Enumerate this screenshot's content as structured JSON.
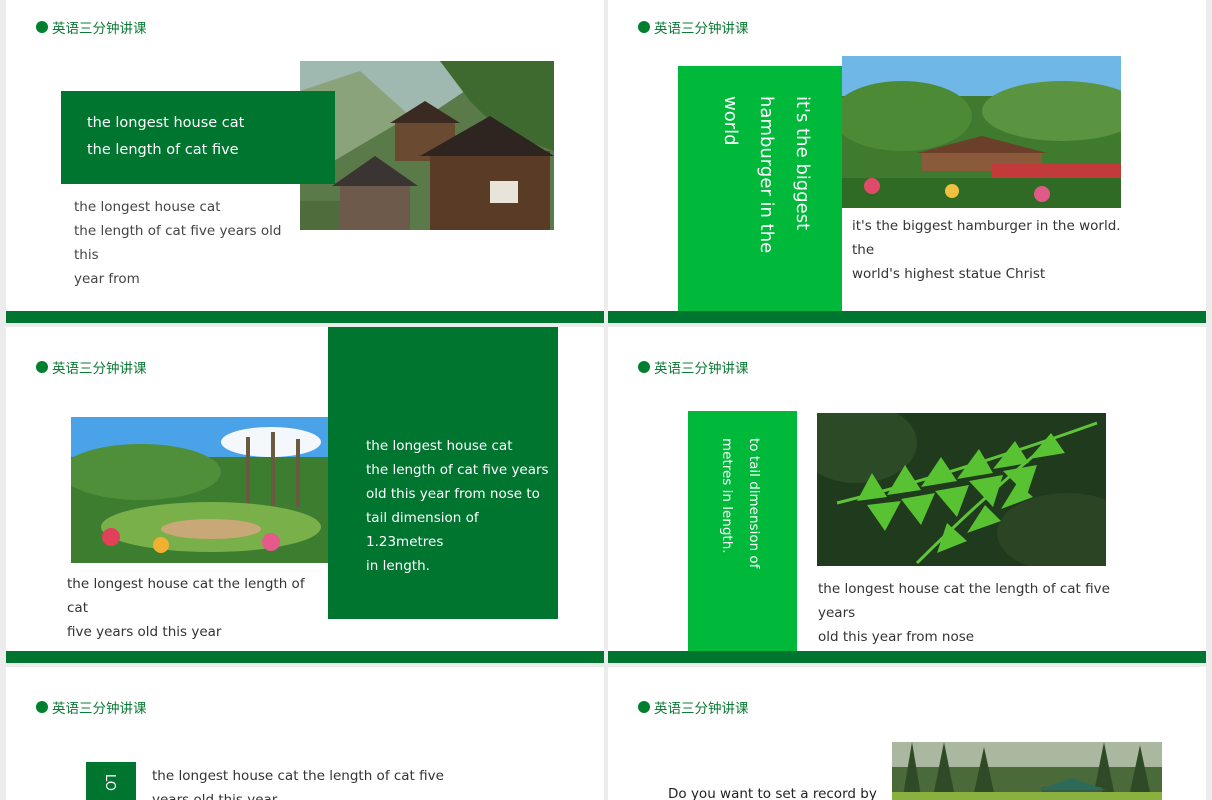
{
  "tag_label": "英语三分钟讲课",
  "colors": {
    "dark_green": "#007530",
    "light_green": "#00b83a"
  },
  "slides": [
    {
      "box": {
        "line1": "the longest house cat",
        "line2": "the length of cat five"
      },
      "body": {
        "line1": "the longest house cat",
        "line2": "the length of cat five years old this",
        "line3": "year from"
      }
    },
    {
      "vertical": {
        "line1": "it's the biggest",
        "line2": "hamburger  in  the",
        "line3": "world"
      },
      "body": {
        "line1": "it's the biggest hamburger  in  the world. the",
        "line2": "world's  highest statue  Christ"
      }
    },
    {
      "box": {
        "line1": "the longest house cat",
        "line2": "the length of cat five years",
        "line3": "old this year from nose to",
        "line4": "tail  dimension of 1.23metres",
        "line5": "in length."
      },
      "body": {
        "line1": "the longest house cat  the length of cat",
        "line2": "five years old this year"
      }
    },
    {
      "vertical": {
        "line1": "to tail  dimension of",
        "line2": "metres in length."
      },
      "body": {
        "line1": "the longest house cat  the length of cat five years",
        "line2": "old this year from nose"
      }
    },
    {
      "vertical": {
        "line1": "LO"
      },
      "body": {
        "line1": "the longest house cat  the length of cat five",
        "line2": "years old this year"
      }
    },
    {
      "body": {
        "line1": "Do you want to set  a  record by"
      }
    }
  ]
}
